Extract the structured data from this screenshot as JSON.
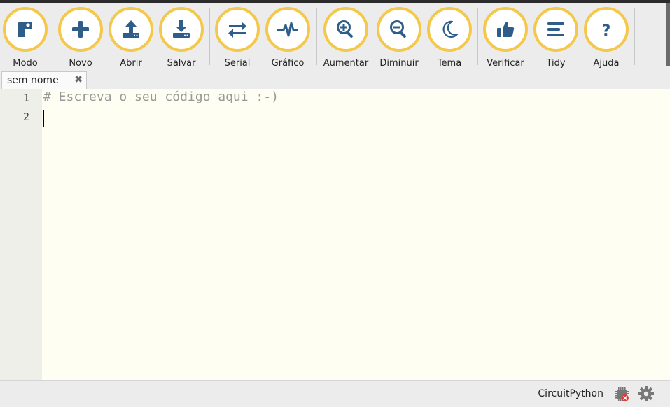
{
  "toolbar": {
    "buttons": [
      {
        "label": "Modo",
        "icon": "mode-icon"
      },
      {
        "label": "Novo",
        "icon": "plus-icon"
      },
      {
        "label": "Abrir",
        "icon": "upload-icon"
      },
      {
        "label": "Salvar",
        "icon": "download-icon"
      },
      {
        "label": "Serial",
        "icon": "exchange-icon"
      },
      {
        "label": "Gráfico",
        "icon": "pulse-icon"
      },
      {
        "label": "Aumentar",
        "icon": "zoom-in-icon"
      },
      {
        "label": "Diminuir",
        "icon": "zoom-out-icon"
      },
      {
        "label": "Tema",
        "icon": "moon-icon"
      },
      {
        "label": "Verificar",
        "icon": "thumbs-up-icon"
      },
      {
        "label": "Tidy",
        "icon": "lines-icon"
      },
      {
        "label": "Ajuda",
        "icon": "help-icon"
      }
    ]
  },
  "tabs": [
    {
      "title": "sem nome",
      "close": "✖"
    }
  ],
  "editor": {
    "lines": [
      {
        "number": "1",
        "text": "# Escreva o seu código aqui :-)"
      },
      {
        "number": "2",
        "text": ""
      }
    ]
  },
  "status": {
    "mode": "CircuitPython",
    "board_icon": "chip-disconnected-icon",
    "settings_icon": "gear-icon"
  },
  "colors": {
    "accent": "#f4c84a",
    "icon": "#2f5d8a",
    "editor_bg": "#fefef2"
  }
}
